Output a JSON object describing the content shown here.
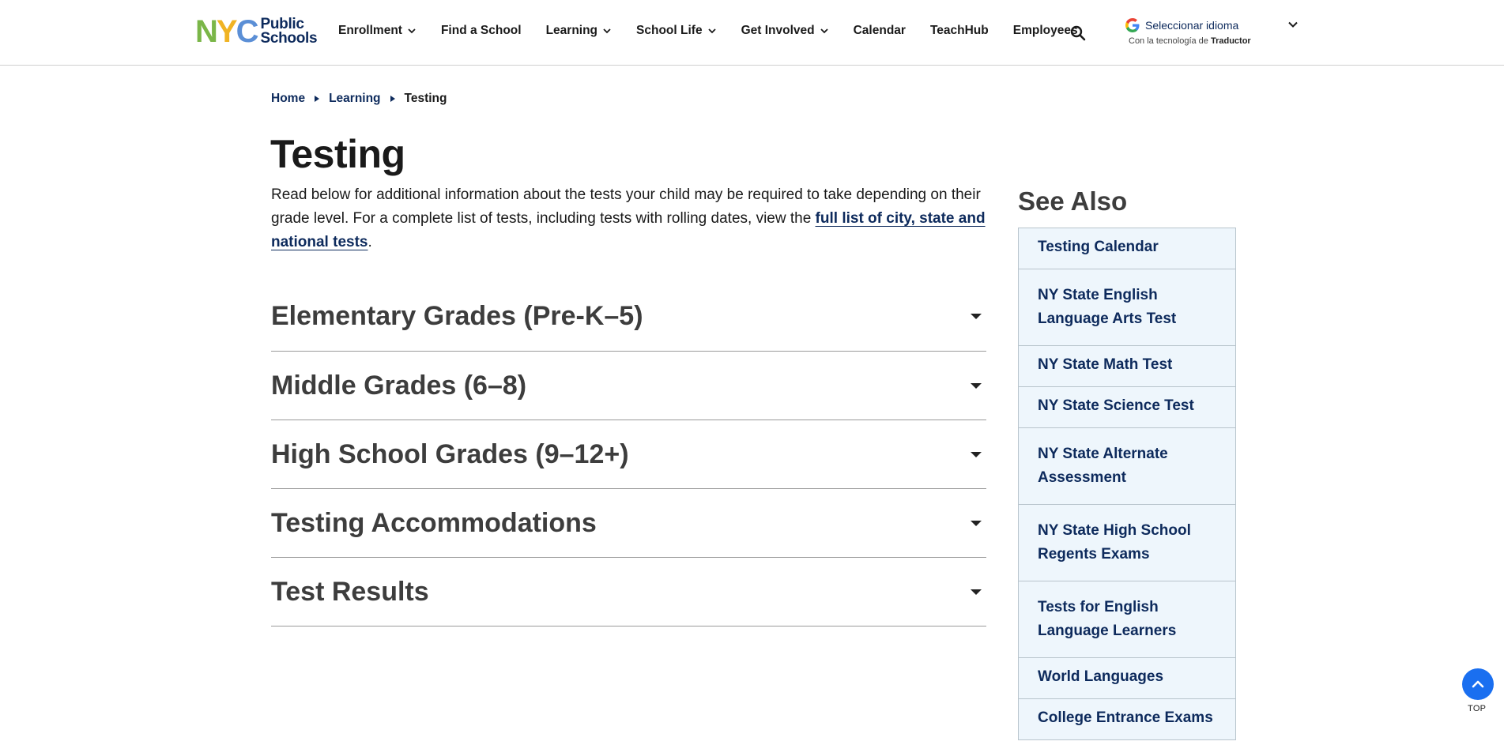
{
  "header": {
    "logo": {
      "nyc": "NYC",
      "line1": "Public",
      "line2": "Schools"
    },
    "nav": [
      {
        "label": "Enrollment",
        "dropdown": true
      },
      {
        "label": "Find a School",
        "dropdown": false
      },
      {
        "label": "Learning",
        "dropdown": true
      },
      {
        "label": "School Life",
        "dropdown": true
      },
      {
        "label": "Get Involved",
        "dropdown": true
      },
      {
        "label": "Calendar",
        "dropdown": false
      },
      {
        "label": "TeachHub",
        "dropdown": false
      },
      {
        "label": "Employees",
        "dropdown": false
      }
    ],
    "translate": {
      "select_label": "Seleccionar idioma",
      "powered_prefix": "Con la tecnología de",
      "powered_brand": "Traductor"
    }
  },
  "breadcrumb": {
    "home": "Home",
    "section": "Learning",
    "current": "Testing"
  },
  "main": {
    "title": "Testing",
    "intro_text": "Read below for additional information about the tests your child may be required to take depending on their grade level. For a complete list of tests, including tests with rolling dates, view the ",
    "intro_link": "full list of city, state and national tests",
    "intro_end": ".",
    "accordion": [
      "Elementary Grades (Pre-K–5)",
      "Middle Grades (6–8)",
      "High School Grades (9–12+)",
      "Testing Accommodations",
      "Test Results"
    ]
  },
  "see_also": {
    "title": "See Also",
    "items": [
      "Testing Calendar",
      "NY State English Language Arts Test",
      "NY State Math Test",
      "NY State Science Test",
      "NY State Alternate Assessment",
      "NY State High School Regents Exams",
      "Tests for English Language Learners",
      "World Languages",
      "College Entrance Exams"
    ]
  },
  "top_button": {
    "label": "TOP"
  },
  "colors": {
    "brand_navy": "#0d2a5c",
    "sidebar_bg": "#eef6fc",
    "top_button": "#1a6ff0"
  }
}
